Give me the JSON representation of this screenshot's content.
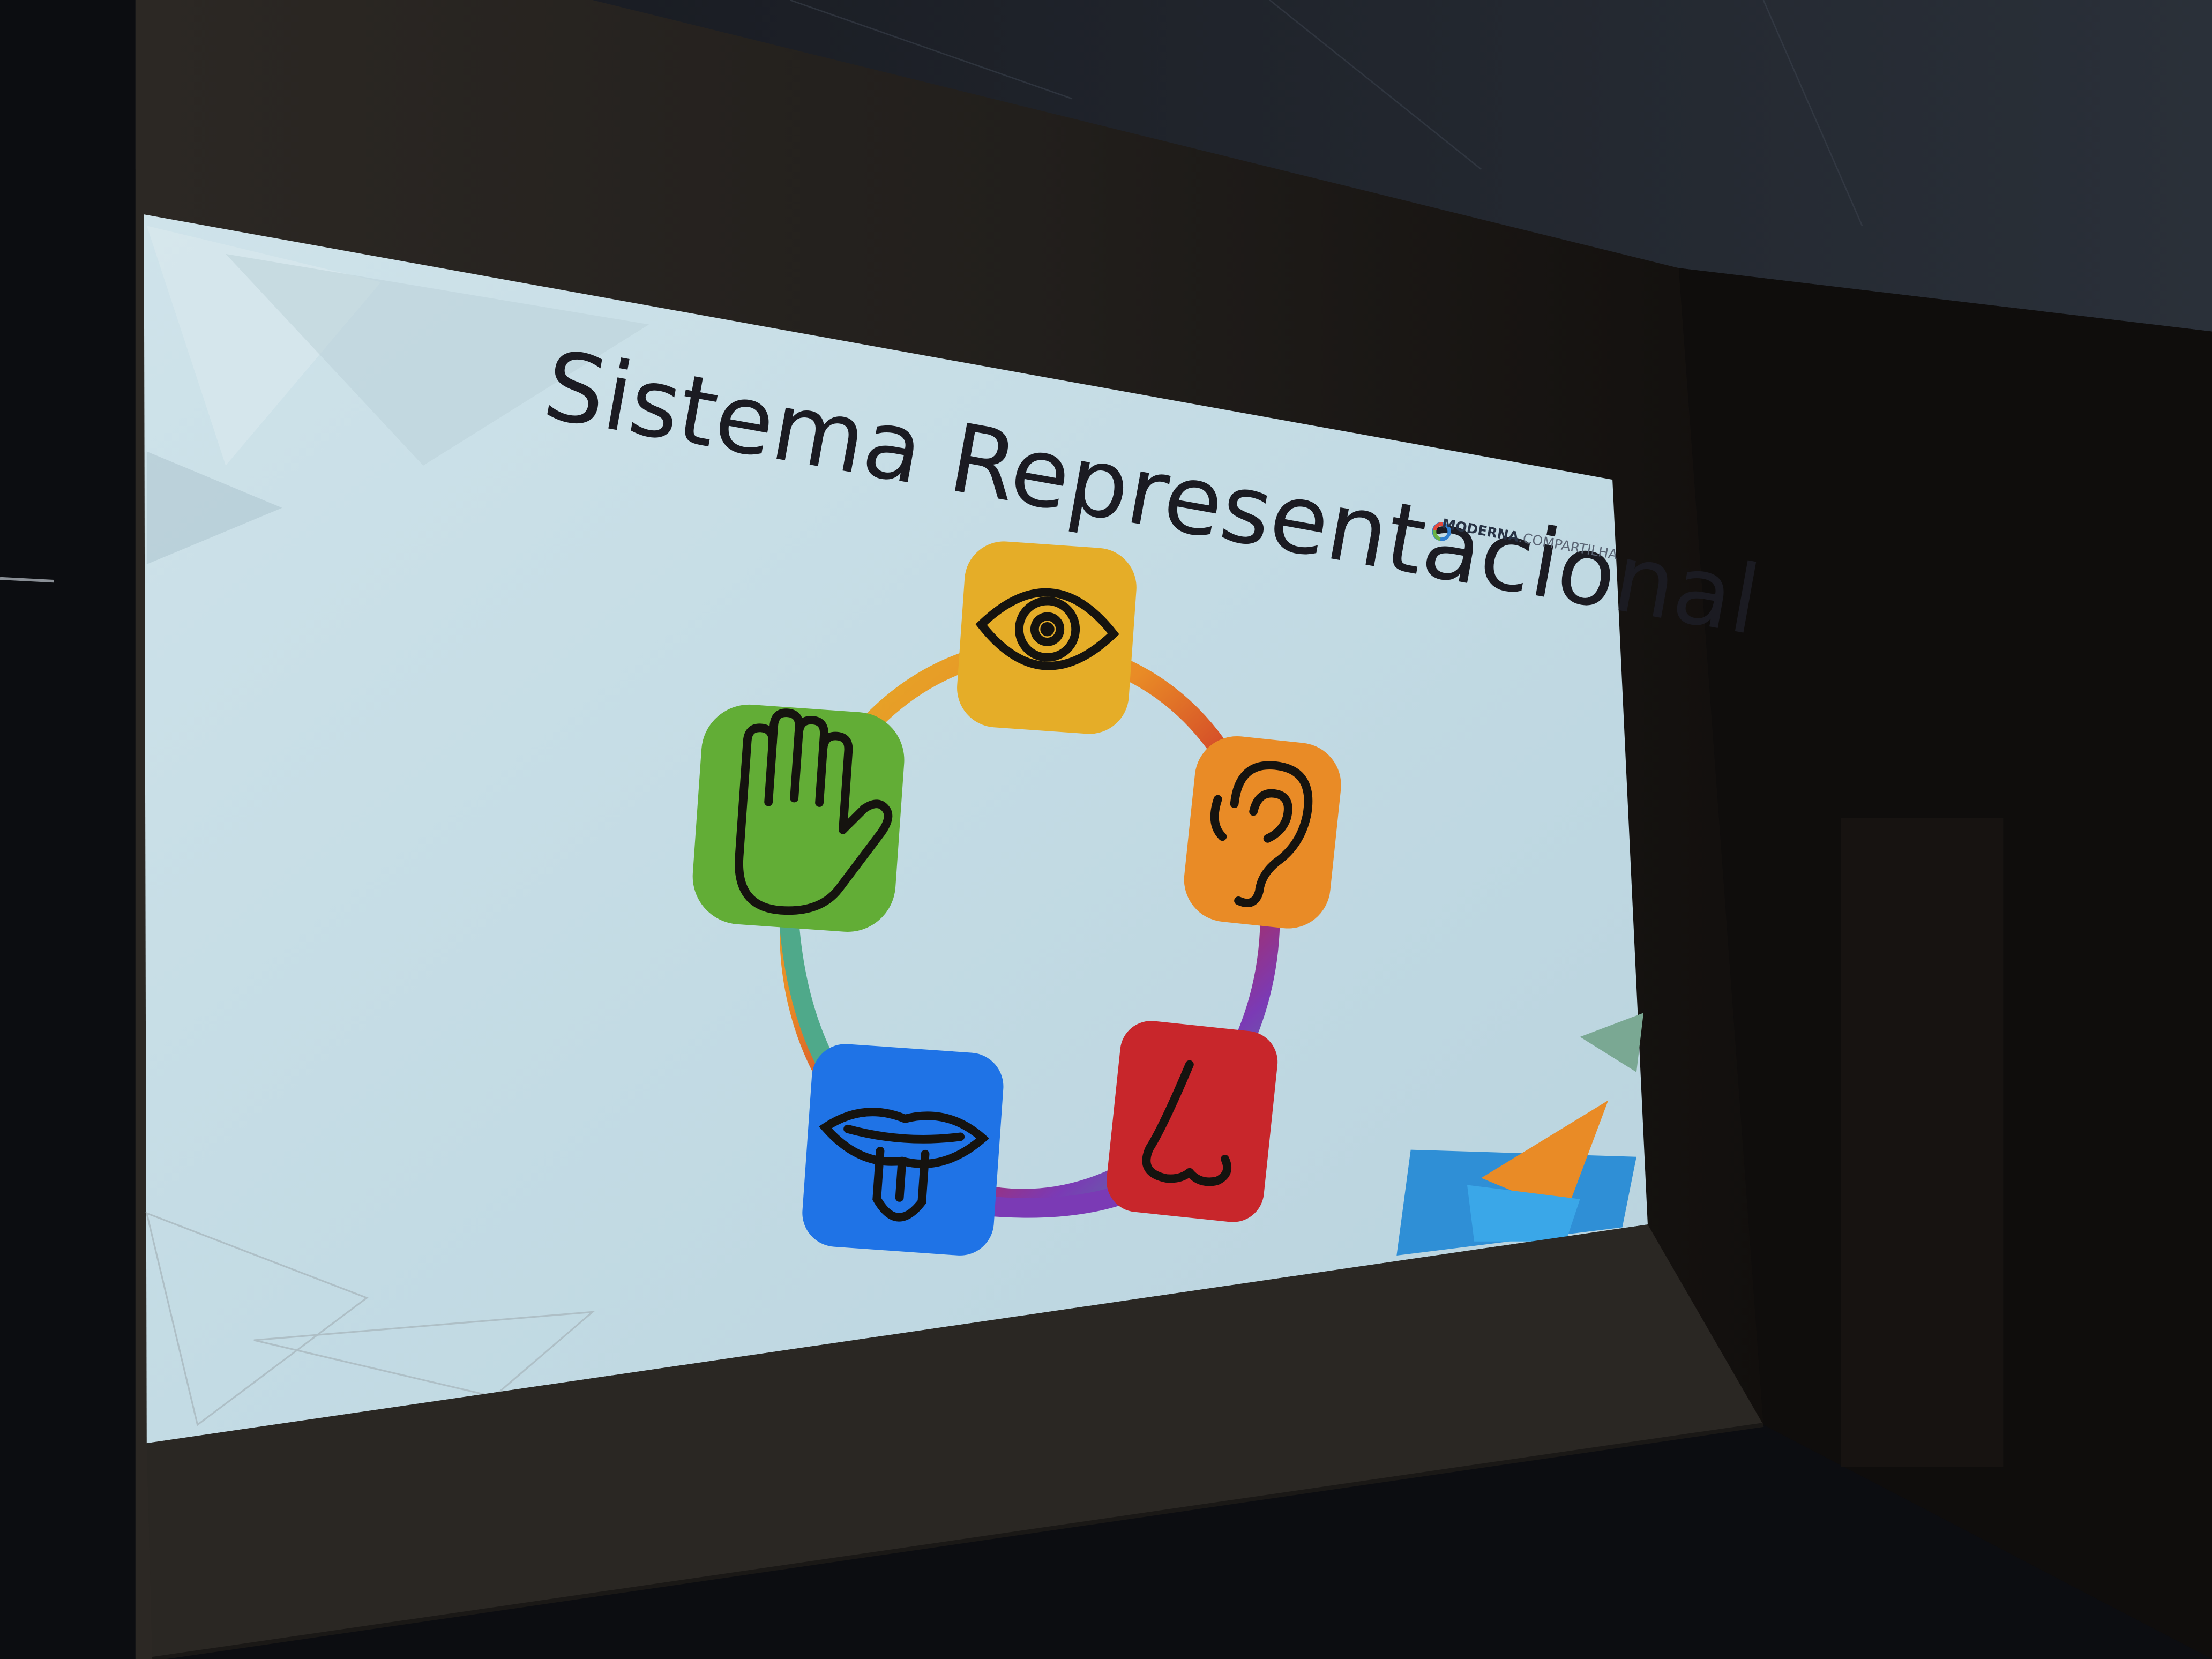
{
  "slide": {
    "title": "Sistema Representacional",
    "brand": {
      "name_bold": "MODERNA",
      "name_light": ".COMPARTILHA"
    }
  },
  "senses": [
    {
      "name": "eye-icon",
      "sense": "visual",
      "color": "#e5ad28"
    },
    {
      "name": "ear-icon",
      "sense": "auditory",
      "color": "#e98b26"
    },
    {
      "name": "nose-icon",
      "sense": "olfactory",
      "color": "#c8262b"
    },
    {
      "name": "tongue-icon",
      "sense": "gustatory",
      "color": "#1f73e6"
    },
    {
      "name": "hand-icon",
      "sense": "kinesthetic",
      "color": "#62ad36"
    }
  ],
  "colors": {
    "room": "#0c0d11",
    "wall": "#24211d",
    "slide_background": "#c6dde6",
    "ring_gradient": [
      "#e5ad28",
      "#e98b26",
      "#c8262b",
      "#7b3ab5",
      "#1f73e6",
      "#3ca88f",
      "#62ad36"
    ]
  }
}
